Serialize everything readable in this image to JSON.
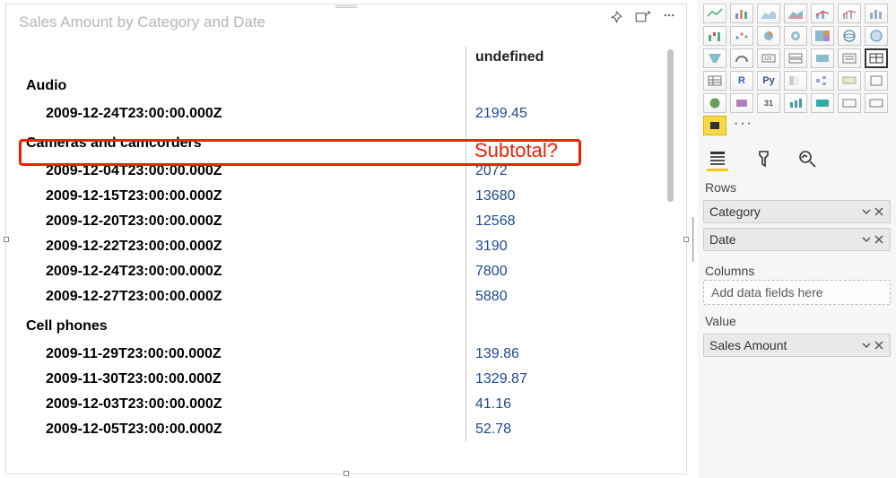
{
  "visual": {
    "title": "Sales Amount by Category and Date",
    "column_header": "undefined",
    "categories": [
      {
        "name": "Audio",
        "rows": [
          {
            "label": "2009-12-24T23:00:00.000Z",
            "value": "2199.45"
          }
        ]
      },
      {
        "name": "Cameras and camcorders",
        "rows": [
          {
            "label": "2009-12-04T23:00:00.000Z",
            "value": "2072"
          },
          {
            "label": "2009-12-15T23:00:00.000Z",
            "value": "13680"
          },
          {
            "label": "2009-12-20T23:00:00.000Z",
            "value": "12568"
          },
          {
            "label": "2009-12-22T23:00:00.000Z",
            "value": "3190"
          },
          {
            "label": "2009-12-24T23:00:00.000Z",
            "value": "7800"
          },
          {
            "label": "2009-12-27T23:00:00.000Z",
            "value": "5880"
          }
        ]
      },
      {
        "name": "Cell phones",
        "rows": [
          {
            "label": "2009-11-29T23:00:00.000Z",
            "value": "139.86"
          },
          {
            "label": "2009-11-30T23:00:00.000Z",
            "value": "1329.87"
          },
          {
            "label": "2009-12-03T23:00:00.000Z",
            "value": "41.16"
          },
          {
            "label": "2009-12-05T23:00:00.000Z",
            "value": "52.78"
          }
        ]
      }
    ]
  },
  "annotation": {
    "text": "Subtotal?"
  },
  "pane": {
    "tabs": {
      "fields": "Fields",
      "format": "Format",
      "analytics": "Analytics"
    },
    "sections": {
      "rows_label": "Rows",
      "rows_fields": [
        {
          "name": "Category"
        },
        {
          "name": "Date"
        }
      ],
      "columns_label": "Columns",
      "columns_placeholder": "Add data fields here",
      "value_label": "Value",
      "value_fields": [
        {
          "name": "Sales Amount"
        }
      ]
    }
  }
}
